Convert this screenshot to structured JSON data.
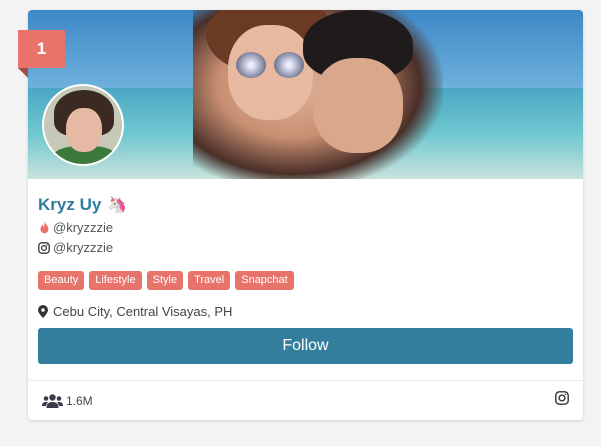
{
  "rank": "1",
  "profile": {
    "name": "Kryz Uy",
    "name_emoji": "🦄",
    "tiktok_handle": "@kryzzzie",
    "instagram_handle": "@kryzzzie",
    "tags": [
      "Beauty",
      "Lifestyle",
      "Style",
      "Travel",
      "Snapchat"
    ],
    "location": "Cebu City, Central Visayas, PH"
  },
  "actions": {
    "follow_label": "Follow"
  },
  "stats": {
    "followers": "1.6M"
  },
  "icons": {
    "handle1": "fire-icon",
    "handle2": "instagram-icon",
    "location": "map-pin-icon",
    "followers": "users-icon",
    "footer_platform": "instagram-icon"
  },
  "colors": {
    "accent": "#e8736b",
    "primary": "#337e9d",
    "name": "#2f7d9e"
  }
}
